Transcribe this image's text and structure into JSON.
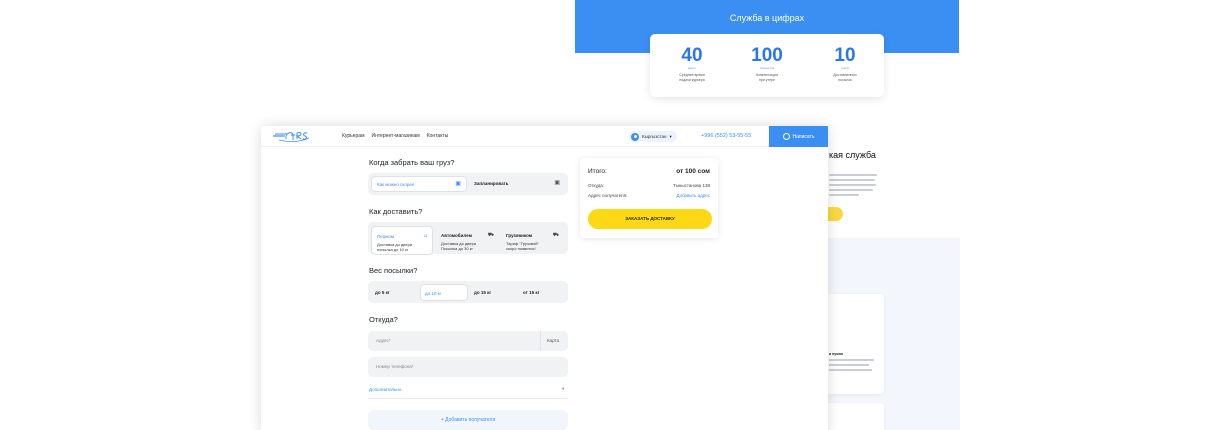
{
  "background": {
    "banner_title": "Служба в цифрах",
    "stats": [
      {
        "number": "40",
        "unit": "минут",
        "desc_line1": "Среднее время",
        "desc_line2": "подачи курьера"
      },
      {
        "number": "100",
        "unit": "процентов",
        "desc_line1": "Компенсация",
        "desc_line2": "при утере"
      },
      {
        "number": "10",
        "unit": "тысяч",
        "desc_line1": "Доставленных",
        "desc_line2": "посылок"
      }
    ],
    "right_heading": "кая служба",
    "card_title": "и нужно"
  },
  "nav": {
    "links": [
      "Курьерам",
      "Интернет-магазинам",
      "Контакты"
    ],
    "region": "Кыргызстан",
    "phone": "+996 (552) 53-55-55",
    "write_label": "Написать"
  },
  "pickup": {
    "title": "Когда забрать ваш груз?",
    "options": [
      "Как можно скорее",
      "Запланировать"
    ]
  },
  "delivery": {
    "title": "Как доставить?",
    "options": [
      {
        "label": "Пешком",
        "line1": "Доставка до двери",
        "line2": "посылка до 10 кг"
      },
      {
        "label": "Автомобилем",
        "line1": "Доставка до двери",
        "line2": "Посылка до 30 кг"
      },
      {
        "label": "Грузовиком",
        "line1": "Тариф \"Грузовой\"",
        "line2": "скоро появится!"
      }
    ]
  },
  "weight": {
    "title": "Вес посылки?",
    "options": [
      "до 5 кг",
      "до 10 кг",
      "до 15 кг",
      "от 15 кг"
    ]
  },
  "from": {
    "title": "Откуда?",
    "address_placeholder": "Адрес*",
    "map_label": "Карта",
    "phone_placeholder": "Номер телефона*",
    "extra_label": "Дополнительно",
    "add_recipient": "Добавить получателя"
  },
  "summary": {
    "total_label": "Итого:",
    "total_value": "от 100 сом",
    "from_label": "Откуда:",
    "from_value": "Тыныстанова 138",
    "recipient_label": "Адрес получателя:",
    "recipient_link": "Добавить адрес",
    "order_button": "ЗАКАЗАТЬ ДОСТАВКУ"
  },
  "colors": {
    "accent": "#3b8ff3",
    "order": "#fcd914"
  }
}
